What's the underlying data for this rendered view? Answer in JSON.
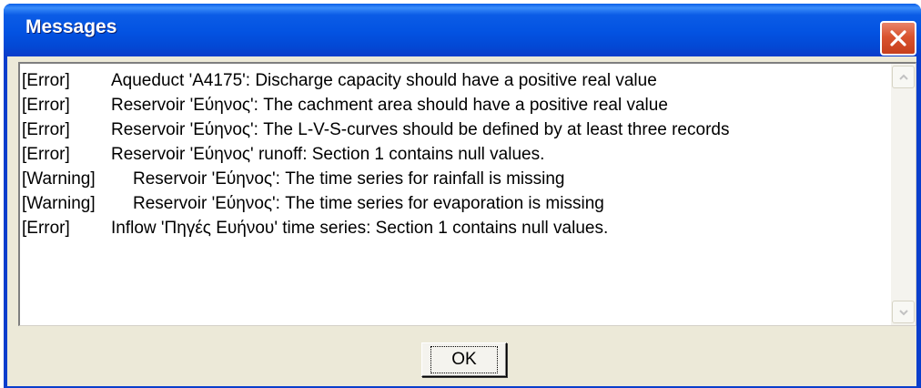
{
  "window": {
    "title": "Messages",
    "close_icon": "close-icon"
  },
  "messages": [
    {
      "level": "[Error]",
      "text": "Aqueduct 'A4175': Discharge capacity should have a positive real value"
    },
    {
      "level": "[Error]",
      "text": "Reservoir 'Εύηνος': The cachment area should have a positive real value"
    },
    {
      "level": "[Error]",
      "text": "Reservoir 'Εύηνος': The L-V-S-curves should be defined by at least three records"
    },
    {
      "level": "[Error]",
      "text": "Reservoir 'Εύηνος' runoff: Section 1 contains null values."
    },
    {
      "level": "[Warning]",
      "text": "Reservoir 'Εύηνος': The time series for rainfall is missing"
    },
    {
      "level": "[Warning]",
      "text": "Reservoir 'Εύηνος': The time series for evaporation is missing"
    },
    {
      "level": "[Error]",
      "text": "Inflow 'Πηγές Ευήνου' time series: Section 1 contains null values."
    }
  ],
  "buttons": {
    "ok_label": "OK"
  },
  "icons": {
    "scroll_up": "scroll-up-arrow-icon",
    "scroll_down": "scroll-down-arrow-icon"
  }
}
